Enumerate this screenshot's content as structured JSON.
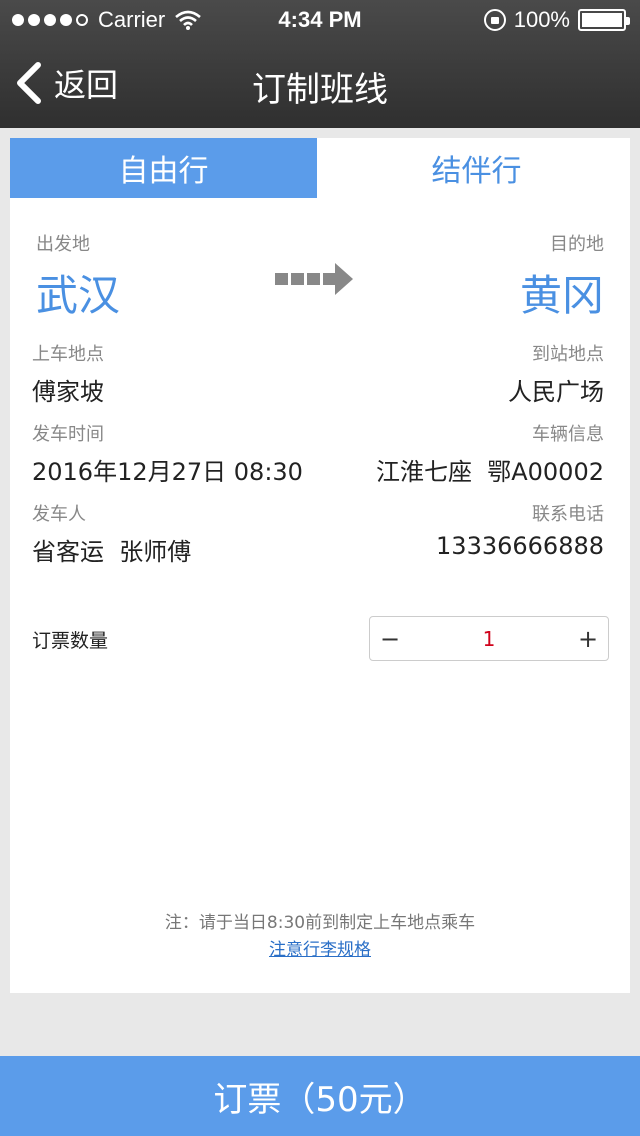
{
  "status_bar": {
    "carrier": "Carrier",
    "time": "4:34 PM",
    "battery": "100%"
  },
  "nav": {
    "back_label": "返回",
    "title": "订制班线"
  },
  "tabs": [
    {
      "label": "自由行",
      "active": true
    },
    {
      "label": "结伴行",
      "active": false
    }
  ],
  "route": {
    "origin_label": "出发地",
    "origin": "武汉",
    "destination_label": "目的地",
    "destination": "黄冈"
  },
  "details": {
    "pickup_label": "上车地点",
    "pickup": "傅家坡",
    "arrival_label": "到站地点",
    "arrival": "人民广场",
    "departure_time_label": "发车时间",
    "departure_time": "2016年12月27日 08:30",
    "vehicle_label": "车辆信息",
    "vehicle": "江淮七座  鄂A00002",
    "operator_label": "发车人",
    "operator": "省客运  张师傅",
    "phone_label": "联系电话",
    "phone": "13336666888"
  },
  "quantity": {
    "label": "订票数量",
    "minus": "−",
    "value": "1",
    "plus": "+"
  },
  "note": "注：请于当日8:30前到制定上车地点乘车",
  "rules_link": "注意行李规格",
  "order_button": "订票（50元）",
  "colors": {
    "accent": "#5b9cea",
    "link": "#2a6fc7",
    "qty": "#d0021b"
  }
}
